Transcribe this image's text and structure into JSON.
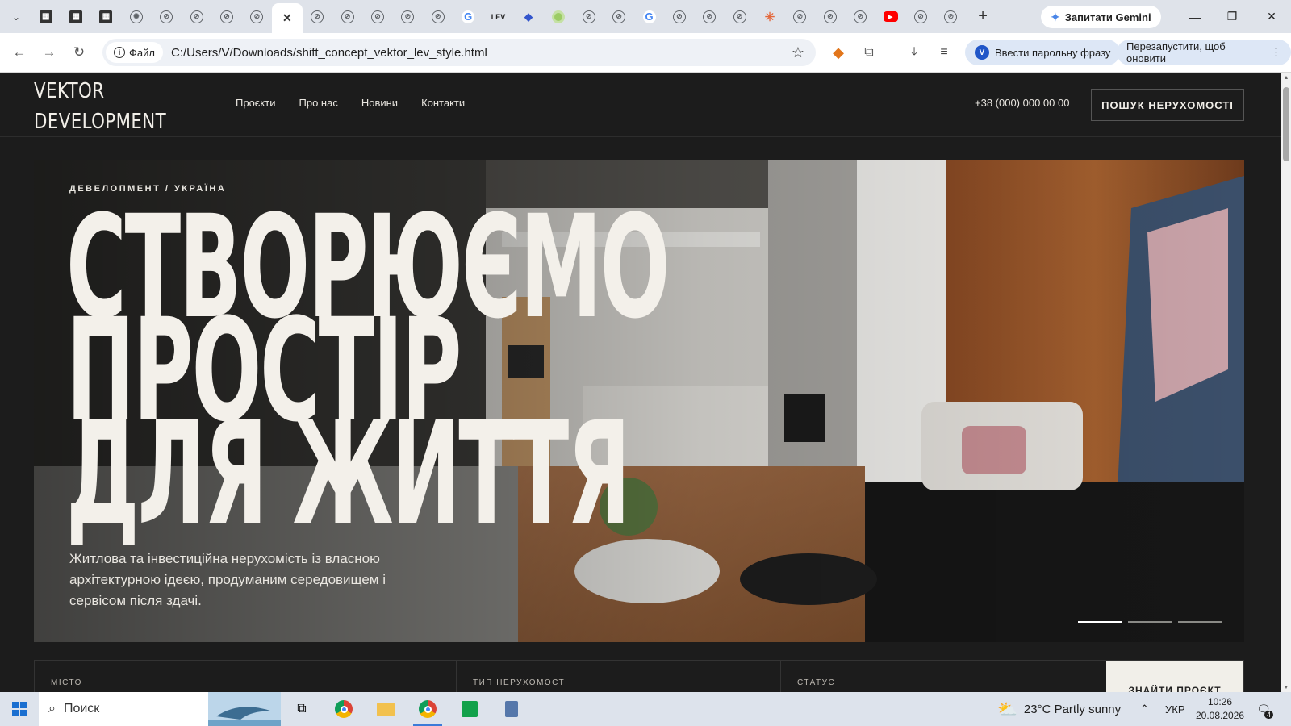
{
  "browser": {
    "tabs": [
      {
        "icon": "grid-favicon-icon",
        "glyph": "▦"
      },
      {
        "icon": "grid-favicon-icon",
        "glyph": "▦"
      },
      {
        "icon": "grid-favicon-icon",
        "glyph": "▦"
      },
      {
        "icon": "openai-favicon-icon",
        "glyph": "✺"
      },
      {
        "icon": "globe-icon",
        "glyph": "⊘"
      },
      {
        "icon": "globe-icon",
        "glyph": "⊘"
      },
      {
        "icon": "globe-icon",
        "glyph": "⊘"
      },
      {
        "icon": "globe-icon",
        "glyph": "⊘"
      },
      {
        "icon": "close-icon",
        "glyph": "✕",
        "active": true
      },
      {
        "icon": "globe-icon",
        "glyph": "⊘"
      },
      {
        "icon": "globe-icon",
        "glyph": "⊘"
      },
      {
        "icon": "globe-icon",
        "glyph": "⊘"
      },
      {
        "icon": "globe-icon",
        "glyph": "⊘"
      },
      {
        "icon": "globe-icon",
        "glyph": "⊘"
      },
      {
        "icon": "google-icon",
        "glyph": "G"
      },
      {
        "icon": "lev-favicon-icon",
        "glyph": "LEV"
      },
      {
        "icon": "diamond-icon",
        "glyph": "◆"
      },
      {
        "icon": "green-circle-icon",
        "glyph": ""
      },
      {
        "icon": "globe-icon",
        "glyph": "⊘"
      },
      {
        "icon": "globe-icon",
        "glyph": "⊘"
      },
      {
        "icon": "google-icon",
        "glyph": "G"
      },
      {
        "icon": "globe-icon",
        "glyph": "⊘"
      },
      {
        "icon": "globe-icon",
        "glyph": "⊘"
      },
      {
        "icon": "globe-icon",
        "glyph": "⊘"
      },
      {
        "icon": "claude-burst-icon",
        "glyph": "✳"
      },
      {
        "icon": "globe-icon",
        "glyph": "⊘"
      },
      {
        "icon": "globe-icon",
        "glyph": "⊘"
      },
      {
        "icon": "globe-icon",
        "glyph": "⊘"
      },
      {
        "icon": "youtube-icon",
        "glyph": "▶"
      },
      {
        "icon": "globe-icon",
        "glyph": "⊘"
      },
      {
        "icon": "globe-icon",
        "glyph": "⊘"
      }
    ],
    "new_tab": "+",
    "gemini_label": "Запитати Gemini",
    "site_chip": "Файл",
    "url": "C:/Users/V/Downloads/shift_concept_vektor_lev_style.html",
    "passphrase_label": "Ввести парольну фразу",
    "restart_label": "Перезапустити, щоб оновити",
    "restart_menu": "⋮"
  },
  "site": {
    "logo_line1": "VEKTOR",
    "logo_line2": "DEVELOPMENT",
    "nav": [
      "Проєкти",
      "Про нас",
      "Новини",
      "Контакти"
    ],
    "phone": "+38 (000) 000 00 00",
    "cta": "ПОШУК НЕРУХОМОСТІ"
  },
  "hero": {
    "eyebrow": "ДЕВЕЛОПМЕНТ / УКРАЇНА",
    "title_line1": "СТВОРЮЄМО",
    "title_line2": "ПРОСТІР",
    "title_line3": "ДЛЯ ЖИТТЯ",
    "subtitle": "Житлова та інвестиційна нерухомість із власною архітектурною ідеєю, продуманим середовищем і сервісом після здачі.",
    "slides_total": 3,
    "slide_active": 1
  },
  "filter": {
    "city_label": "МІСТО",
    "type_label": "ТИП НЕРУХОМОСТІ",
    "status_label": "СТАТУС",
    "button_label": "ЗНАЙТИ ПРОЄКТ"
  },
  "taskbar": {
    "search_placeholder": "Поиск",
    "weather": "23°C  Partly sunny",
    "language": "УКР",
    "time": "10:26",
    "date": "20.08.2026",
    "notifications": "4"
  }
}
